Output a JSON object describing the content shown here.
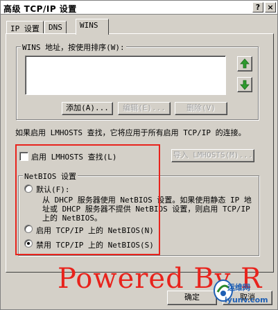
{
  "window": {
    "title": "高级 TCP/IP 设置",
    "help_glyph": "?",
    "close_glyph": "×"
  },
  "tabs": [
    {
      "label": "IP 设置",
      "active": false
    },
    {
      "label": "DNS",
      "active": false
    },
    {
      "label": "WINS",
      "active": true
    }
  ],
  "wins": {
    "group_label": "WINS 地址，按使用排序(W):",
    "list_items": [],
    "add_label": "添加(A)...",
    "edit_label": "编辑(E)...",
    "delete_label": "删除(V)",
    "up_icon": "green-up-arrow-icon",
    "down_icon": "green-down-arrow-icon"
  },
  "lmhosts": {
    "info_text": "如果启用 LMHOSTS 查找，它将应用于所有启用 TCP/IP 的连接。",
    "enable_label": "启用 LMHOSTS 查找(L)",
    "enable_checked": false,
    "import_label": "导入 LMHOSTS(M)..."
  },
  "netbios": {
    "group_label": "NetBIOS 设置",
    "default_label": "默认(F):",
    "default_desc_line1": "从 DHCP 服务器使用 NetBIOS 设置。如果使用静态 IP 地",
    "default_desc_line2": "址或 DHCP 服务器不提供 NetBIOS 设置，则启用 TCP/IP",
    "default_desc_line3": "上的 NetBIOS。",
    "enable_label": "启用 TCP/IP 上的 NetBIOS(N)",
    "disable_label": "禁用 TCP/IP 上的 NetBIOS(S)",
    "selected": "disable"
  },
  "footer": {
    "ok_label": "确定",
    "cancel_label": "取消"
  },
  "overlay": {
    "watermark_text": "Powered By R",
    "logo_text1": "运维网",
    "logo_text2": "iyunv.com",
    "highlight_color": "#e8231c"
  }
}
